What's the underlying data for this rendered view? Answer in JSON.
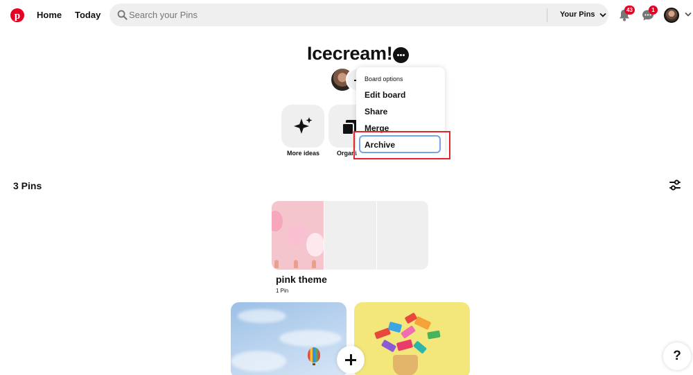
{
  "header": {
    "logo_icon": "pinterest-logo-icon",
    "nav": {
      "home": "Home",
      "today": "Today"
    },
    "search": {
      "placeholder": "Search your Pins",
      "value": ""
    },
    "your_pins": "Your Pins",
    "notifications_badge": "43",
    "messages_badge": "1",
    "brand_color": "#e60023"
  },
  "board": {
    "title": "Icecream!",
    "actions": [
      {
        "label": "More ideas",
        "icon": "sparkle-icon"
      },
      {
        "label": "Organi",
        "icon": "organize-icon"
      }
    ]
  },
  "dropdown": {
    "header": "Board options",
    "items": [
      "Edit board",
      "Share",
      "Merge",
      "Archive"
    ],
    "focused_item": "Archive",
    "focus_color": "#6fa4e8",
    "highlight_color": "#e0252b"
  },
  "pins": {
    "count_label": "3 Pins",
    "section": {
      "title": "pink theme",
      "count": "1 Pin"
    }
  },
  "help_label": "?"
}
